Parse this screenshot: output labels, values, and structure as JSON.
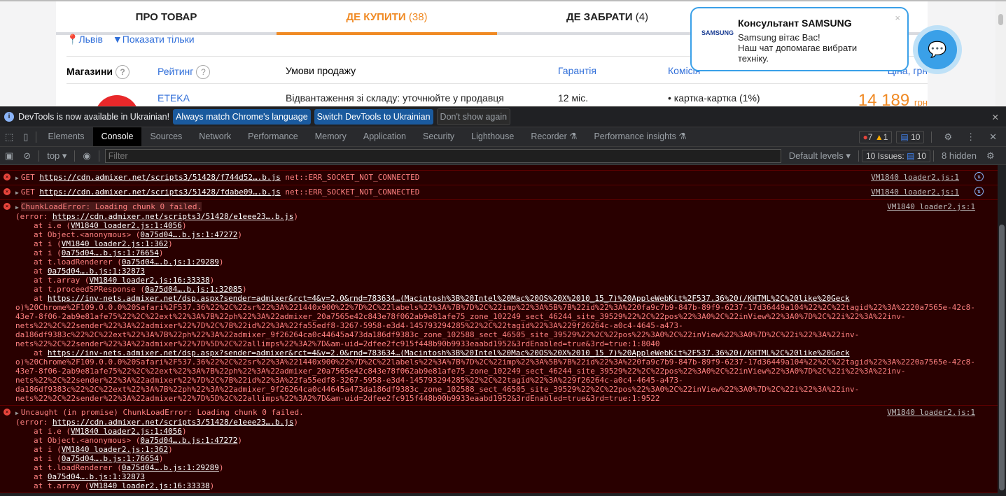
{
  "page": {
    "tabs": [
      {
        "label": "ПРО ТОВАР",
        "count": ""
      },
      {
        "label": "ДЕ КУПИТИ",
        "count": "(38)"
      },
      {
        "label": "ДЕ ЗАБРАТИ",
        "count": "(4)"
      }
    ],
    "location": "Львів",
    "filter": "Показати тільки",
    "headers": {
      "shops": "Магазини",
      "rating": "Рейтинг",
      "conditions": "Умови продажу",
      "warranty": "Гарантія",
      "commission": "Комісія",
      "price": "Ціна, грн"
    },
    "row": {
      "shop": "ETEKA",
      "conditions": "Відвантаження зі складу: уточнюйте у продавця",
      "warranty": "12 міс.",
      "commission": "картка-картка (1%)",
      "price": "14 189",
      "currency": "грн"
    },
    "chat": {
      "logo": "SAMSUNG",
      "title": "Консультант SAMSUNG",
      "line1": "Samsung вітає Вас!",
      "line2": "Наш чат допомагає вибрати техніку."
    },
    "accent": "#f08a24"
  },
  "infobar": {
    "text": "DevTools is now available in Ukrainian!",
    "btn1": "Always match Chrome's language",
    "btn2": "Switch DevTools to Ukrainian",
    "btn3": "Don't show again"
  },
  "devtools": {
    "tabs": [
      "Elements",
      "Console",
      "Sources",
      "Network",
      "Performance",
      "Memory",
      "Application",
      "Security",
      "Lighthouse",
      "Recorder ⚗",
      "Performance insights ⚗"
    ],
    "errors": "7",
    "warnings": "1",
    "messages": "10",
    "context": "top ▾",
    "filter_placeholder": "Filter",
    "levels": "Default levels ▾",
    "issues_label": "10 Issues:",
    "issues_count": "10",
    "hidden": "8 hidden"
  },
  "console": {
    "src": "VM1840 loader2.js:1",
    "get1": {
      "method": "GET",
      "url": "https://cdn.admixer.net/scripts3/51428/f744d52….b.js",
      "err": "net::ERR_SOCKET_NOT_CONNECTED"
    },
    "get2": {
      "method": "GET",
      "url": "https://cdn.admixer.net/scripts3/51428/fdabe09….b.js",
      "err": "net::ERR_SOCKET_NOT_CONNECTED"
    },
    "chunk": {
      "title": "ChunkLoadError: Loading chunk 0 failed.",
      "err_prefix": "(error: ",
      "err_url": "https://cdn.admixer.net/scripts3/51428/e1eee23….b.js"
    },
    "stack": [
      [
        "at i.e (",
        "VM1840 loader2.js:1:4056",
        ")"
      ],
      [
        "at Object.<anonymous> (",
        "0a75d04….b.js:1:47272",
        ")"
      ],
      [
        "at i (",
        "VM1840 loader2.js:1:362",
        ")"
      ],
      [
        "at i (",
        "0a75d04….b.js:1:76654",
        ")"
      ],
      [
        "at t.loadRenderer (",
        "0a75d04….b.js:1:29289",
        ")"
      ],
      [
        "at ",
        "0a75d04….b.js:1:32873",
        ""
      ],
      [
        "at t.array (",
        "VM1840 loader2.js:16:33338",
        ")"
      ],
      [
        "at t.proceedSPResponse (",
        "0a75d04….b.js:1:32085",
        ")"
      ]
    ],
    "dsp1": [
      "https://inv-nets.admixer.net/dsp.aspx?sender=admixer&rct=4&v=2.0&rnd=783634…(Macintosh%3B%20Intel%20Mac%20OS%20X%2010_15_7)%20AppleWebKit%2F537.36%20(/KHTML%2C%20like%20Geck",
      "o)%20Chrome%2F109.0.0.0%20Safari%2F537.36%22%2C%22sr%22%3A%221440x900%22%7D%2C%22labels%22%3A%7B%7D%2C%22imp%22%3A%5B%7B%22id%22%3A%220fa9c7b9-847b-89f9-6237-17d36449a104%22%2C%22tagid%22%3A%2220a7565e-42c8-",
      "43e7-8f06-2ab9e81afe75%22%2C%22ext%22%3A%7B%22ph%22%3A%22admixer_20a7565e42c843e78f062ab9e81afe75_zone_102249_sect_46244_site_39529%22%2C%22pos%22%3A0%2C%22inView%22%3A0%7D%2C%22i%22%3A%22inv-",
      "nets%22%2C%22sender%22%3A%22admixer%22%7D%2C%7B%22id%22%3A%22fa55edf8-3267-5958-e3d4-145793294285%22%2C%22tagid%22%3A%229f26264c-a0c4-4645-a473-",
      "da186df9383c%22%2C%22ext%22%3A%7B%22ph%22%3A%22admixer_9f26264ca0c44645a473da186df9383c_zone_102588_sect_46505_site_39529%22%2C%22pos%22%3A0%2C%22inView%22%3A0%7D%2C%22i%22%3A%22inv-",
      "nets%22%2C%22sender%22%3A%22admixer%22%7D%5D%2C%22allimps%22%3A2%7D&am-uid=2dfee2fc915f448b90b9933eaabd1952&3rdEnabled=true&3rd=true:1:8040"
    ],
    "dsp2_last": "nets%22%2C%22sender%22%3A%22admixer%22%7D%5D%2C%22allimps%22%3A2%7D&am-uid=2dfee2fc915f448b90b9933eaabd1952&3rdEnabled=true&3rd=true:1:9522",
    "uncaught": "Uncaught (in promise) ChunkLoadError: Loading chunk 0 failed."
  }
}
